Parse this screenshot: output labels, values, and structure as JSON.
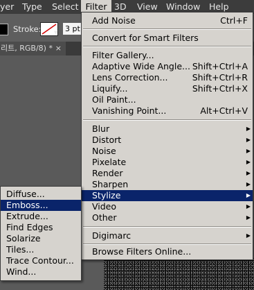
{
  "menubar": {
    "items": [
      "yer",
      "Type",
      "Select",
      "Filter",
      "3D",
      "View",
      "Window",
      "Help"
    ],
    "active": "Filter"
  },
  "options": {
    "stroke_label": "Stroke:",
    "stroke_width": "3 pt"
  },
  "document": {
    "tab_title": "리트, RGB/8) *",
    "close_glyph": "×"
  },
  "filter_menu": {
    "items": [
      {
        "label": "Add Noise",
        "shortcut": "Ctrl+F"
      },
      {
        "label": "Convert for Smart Filters"
      },
      {
        "label": "Filter Gallery..."
      },
      {
        "label": "Adaptive Wide Angle...",
        "shortcut": "Shift+Ctrl+A"
      },
      {
        "label": "Lens Correction...",
        "shortcut": "Shift+Ctrl+R"
      },
      {
        "label": "Liquify...",
        "shortcut": "Shift+Ctrl+X"
      },
      {
        "label": "Oil Paint..."
      },
      {
        "label": "Vanishing Point...",
        "shortcut": "Alt+Ctrl+V"
      },
      {
        "label": "Blur",
        "submenu": true
      },
      {
        "label": "Distort",
        "submenu": true
      },
      {
        "label": "Noise",
        "submenu": true
      },
      {
        "label": "Pixelate",
        "submenu": true
      },
      {
        "label": "Render",
        "submenu": true
      },
      {
        "label": "Sharpen",
        "submenu": true
      },
      {
        "label": "Stylize",
        "submenu": true,
        "highlighted": true
      },
      {
        "label": "Video",
        "submenu": true
      },
      {
        "label": "Other",
        "submenu": true
      },
      {
        "label": "Digimarc",
        "submenu": true
      },
      {
        "label": "Browse Filters Online..."
      }
    ],
    "submenu_glyph": "▶"
  },
  "stylize_submenu": {
    "items": [
      {
        "label": "Diffuse..."
      },
      {
        "label": "Emboss...",
        "highlighted": true
      },
      {
        "label": "Extrude..."
      },
      {
        "label": "Find Edges"
      },
      {
        "label": "Solarize"
      },
      {
        "label": "Tiles..."
      },
      {
        "label": "Trace Contour..."
      },
      {
        "label": "Wind..."
      }
    ]
  },
  "colors": {
    "menu_bg": "#d6d3ce",
    "highlight": "#0a246a",
    "menubar_bg": "#3c3c3c"
  }
}
